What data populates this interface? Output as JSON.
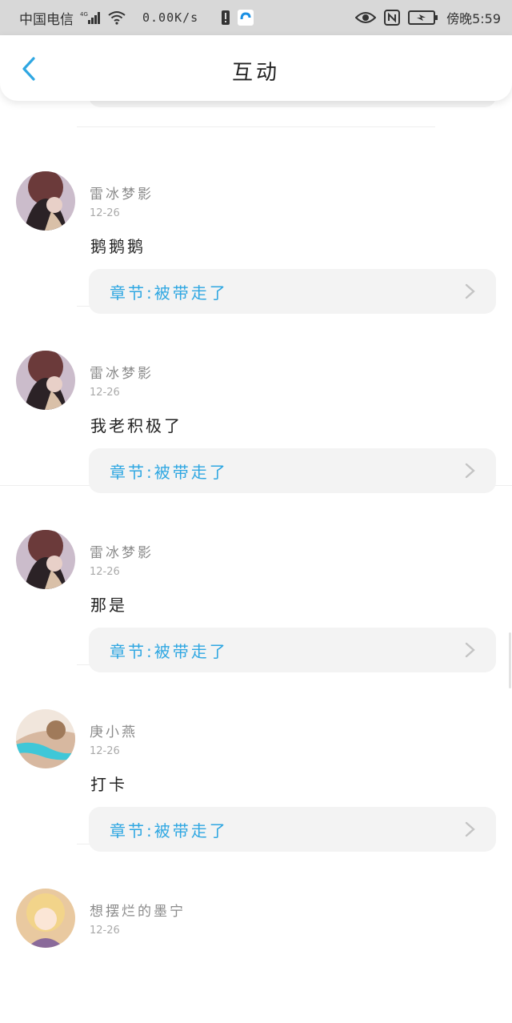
{
  "status_bar": {
    "carrier": "中国电信",
    "network": "4G",
    "speed": "0.00K/s",
    "time": "傍晚5:59"
  },
  "header": {
    "title": "互动"
  },
  "entries": [
    {
      "username": "雷冰梦影",
      "date": "12-26",
      "comment": "鹅鹅鹅",
      "chapter": "章节:被带走了"
    },
    {
      "username": "雷冰梦影",
      "date": "12-26",
      "comment": "我老积极了",
      "chapter": "章节:被带走了"
    },
    {
      "username": "雷冰梦影",
      "date": "12-26",
      "comment": "那是",
      "chapter": "章节:被带走了"
    },
    {
      "username": "庚小燕",
      "date": "12-26",
      "comment": "打卡",
      "chapter": "章节:被带走了"
    },
    {
      "username": "想摆烂的墨宁",
      "date": "12-26",
      "comment": "",
      "chapter": ""
    }
  ],
  "colors": {
    "accent": "#2fa7e2",
    "status_bar_bg": "#d8d8d8",
    "card_bg": "#f3f3f3"
  }
}
